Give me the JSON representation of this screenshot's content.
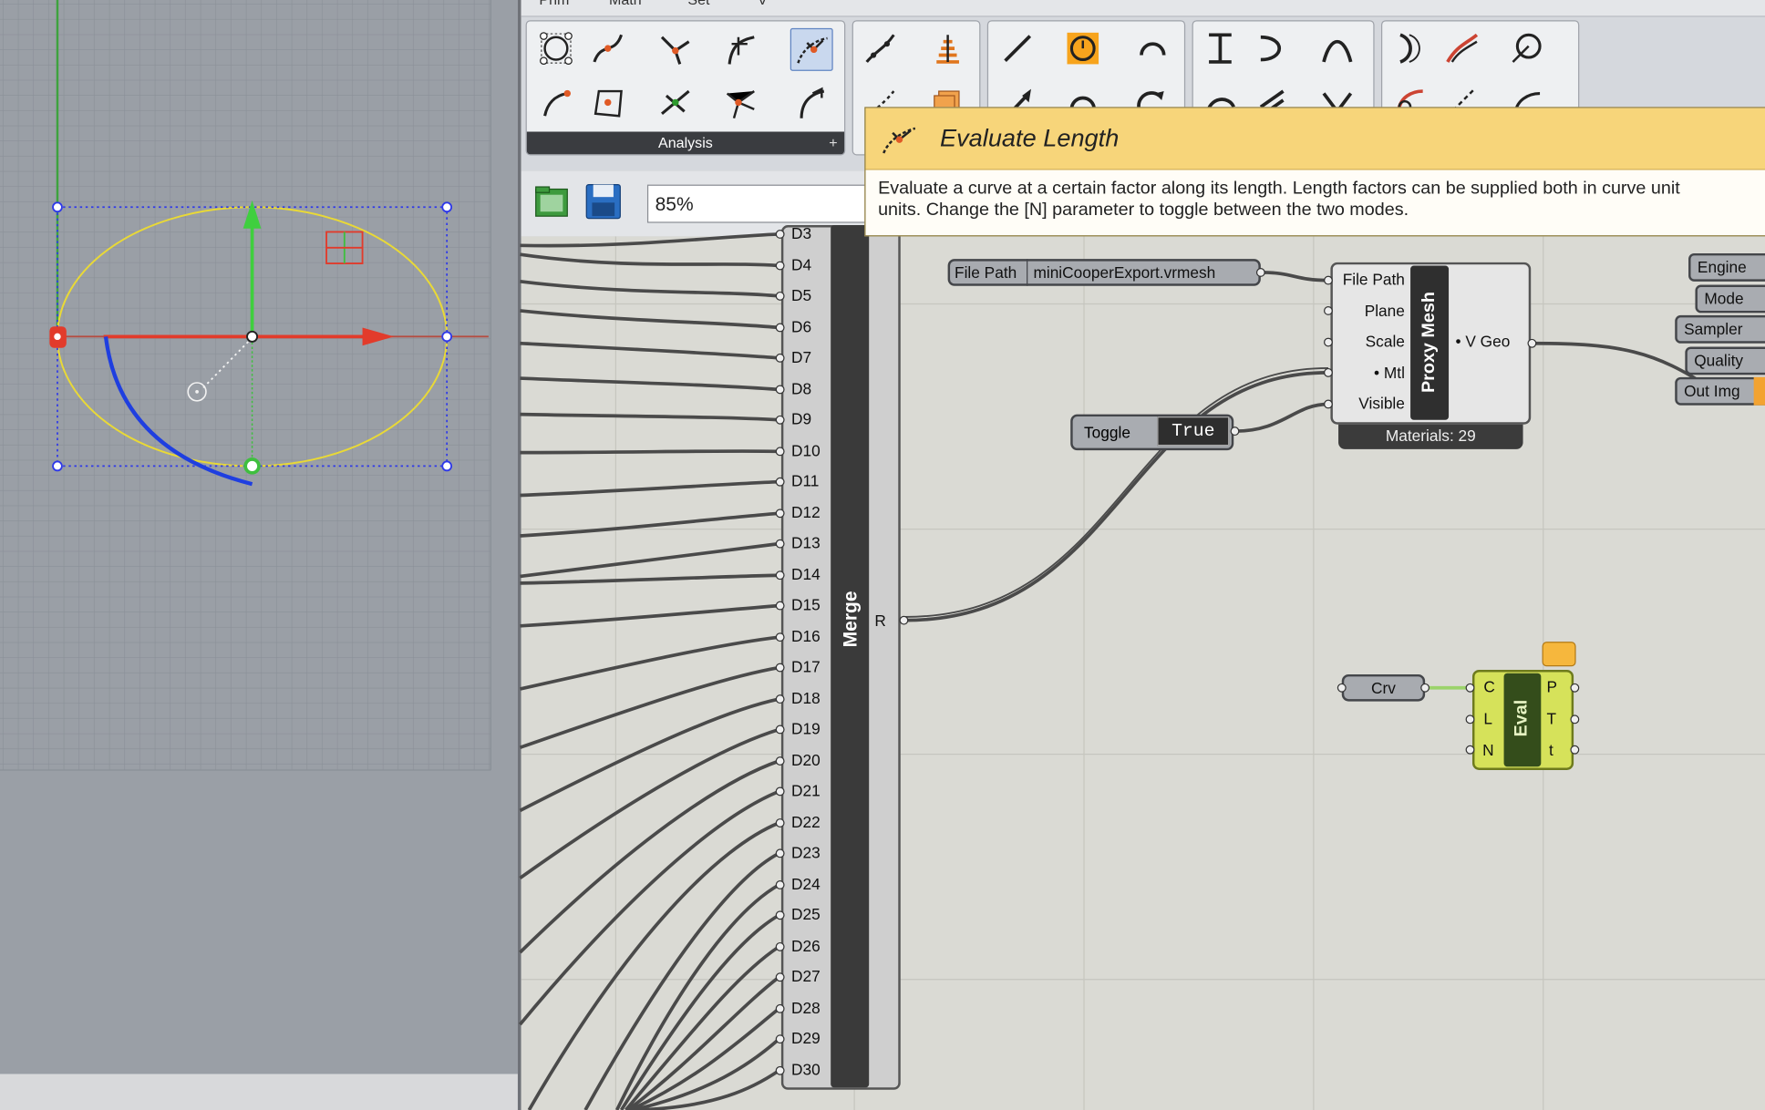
{
  "colors": {
    "rhino_bg": "#9a9fa6",
    "gh_canvas": "#dadad4",
    "tooltip_header": "#f7d57a",
    "eval_component": "#d6e25a",
    "ellipse": "#e9d936",
    "x_axis": "#e23b2b",
    "y_axis": "#3fbf3f",
    "arc": "#1f3fe0"
  },
  "gh_menu": {
    "items": [
      "Prim",
      "Math",
      "Set",
      "V"
    ]
  },
  "ribbon": {
    "analysis_label": "Analysis",
    "plus_label": "+",
    "selected_tool": "evaluate-length-icon"
  },
  "toolbar": {
    "zoom": "85%"
  },
  "tooltip": {
    "title": "Evaluate Length",
    "line1": "Evaluate a curve at a certain factor along its length. Length factors can be supplied both in curve unit",
    "line2": "units. Change the [N] parameter to toggle between the two modes."
  },
  "merge": {
    "name": "Merge",
    "output": "R",
    "inputs": [
      "D3",
      "D4",
      "D5",
      "D6",
      "D7",
      "D8",
      "D9",
      "D10",
      "D11",
      "D12",
      "D13",
      "D14",
      "D15",
      "D16",
      "D17",
      "D18",
      "D19",
      "D20",
      "D21",
      "D22",
      "D23",
      "D24",
      "D25",
      "D26",
      "D27",
      "D28",
      "D29",
      "D30"
    ]
  },
  "file_path": {
    "label": "File Path",
    "value": "miniCooperExport.vrmesh"
  },
  "toggle": {
    "label": "Toggle",
    "value": "True"
  },
  "proxy_mesh": {
    "name": "Proxy Mesh",
    "inputs": [
      "File Path",
      "Plane",
      "Scale",
      "• Mtl",
      "Visible"
    ],
    "output": "• V Geo",
    "materials": "Materials: 29"
  },
  "right_params": [
    "Engine",
    "Mode",
    "Sampler",
    "Quality",
    "Out Img"
  ],
  "crv": {
    "label": "Crv"
  },
  "eval": {
    "name": "Eval",
    "inputs": [
      "C",
      "L",
      "N"
    ],
    "outputs": [
      "P",
      "T",
      "t"
    ]
  }
}
